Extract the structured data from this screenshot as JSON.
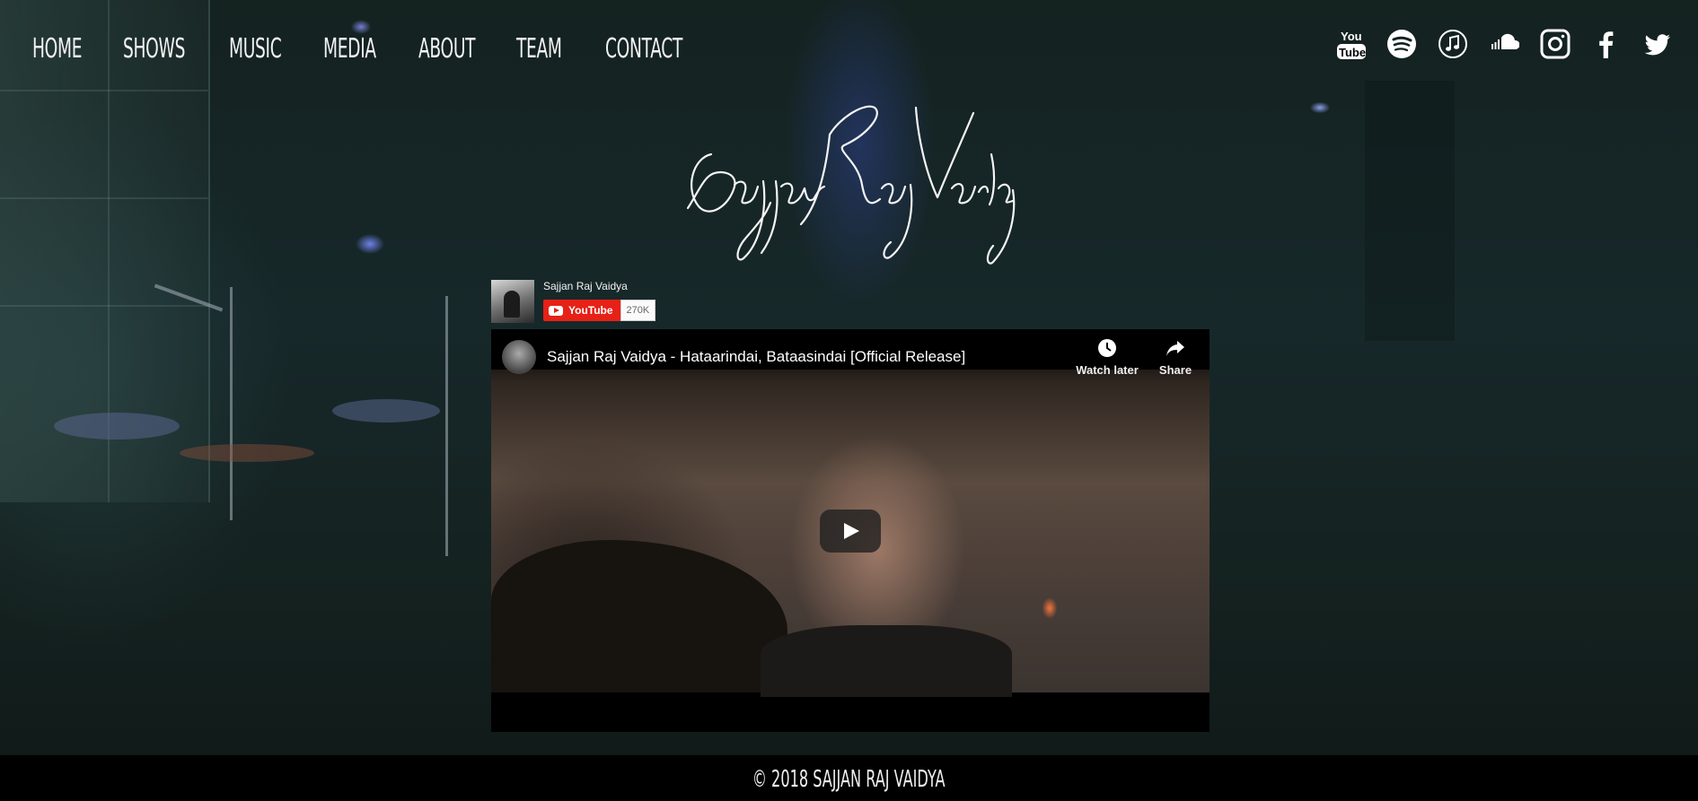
{
  "nav": {
    "items": [
      {
        "label": "HOME"
      },
      {
        "label": "SHOWS"
      },
      {
        "label": "MUSIC"
      },
      {
        "label": "MEDIA"
      },
      {
        "label": "ABOUT"
      },
      {
        "label": "TEAM"
      },
      {
        "label": "CONTACT"
      }
    ]
  },
  "social": {
    "icons": [
      "youtube-icon",
      "spotify-icon",
      "itunes-icon",
      "soundcloud-icon",
      "instagram-icon",
      "facebook-icon",
      "twitter-icon"
    ],
    "youtube_logo_text": "You Tube"
  },
  "signature_text": "Sajjan Raj Vaidya",
  "channel": {
    "name": "Sajjan Raj Vaidya",
    "subscribe_label": "YouTube",
    "subscriber_count": "270K"
  },
  "video": {
    "title": "Sajjan Raj Vaidya - Hataarindai, Bataasindai [Official Release]",
    "watch_later_label": "Watch later",
    "share_label": "Share"
  },
  "footer": {
    "copyright": "© 2018 SAJJAN RAJ VAIDYA"
  },
  "colors": {
    "background": "#142220",
    "nav_text": "#f3f3f3",
    "youtube_red": "#e62117",
    "footer_bg": "#000000"
  }
}
